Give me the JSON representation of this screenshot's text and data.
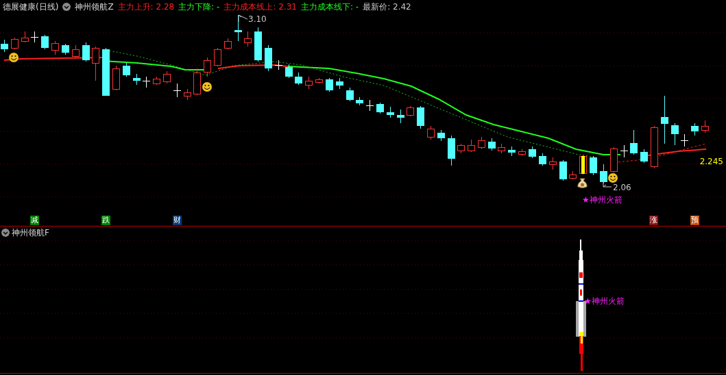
{
  "header": {
    "title": "德展健康(日线)",
    "indicator": "神州领航Z",
    "legend": [
      {
        "text": "主力上升: 2.28",
        "kind": "rise"
      },
      {
        "text": "主力下降: -",
        "kind": "fall"
      },
      {
        "text": "主力成本线上: 2.31",
        "kind": "rise"
      },
      {
        "text": "主力成本线下: -",
        "kind": "fall"
      },
      {
        "text": "最新价: 2.42",
        "kind": "price"
      }
    ]
  },
  "main_chart": {
    "high_label": "3.10",
    "low_label": "2.06",
    "price_label": "2.245",
    "signal_label": "★神州火箭",
    "markers": [
      {
        "text": "减",
        "color": "#008000"
      },
      {
        "text": "跌",
        "color": "#008000"
      },
      {
        "text": "财",
        "color": "#0a3c78"
      },
      {
        "text": "涨",
        "color": "#8c1010"
      },
      {
        "text": "预",
        "color": "#c05010"
      }
    ]
  },
  "sub_panel": {
    "title": "神州领航F",
    "signal_label": "★神州火箭"
  }
}
